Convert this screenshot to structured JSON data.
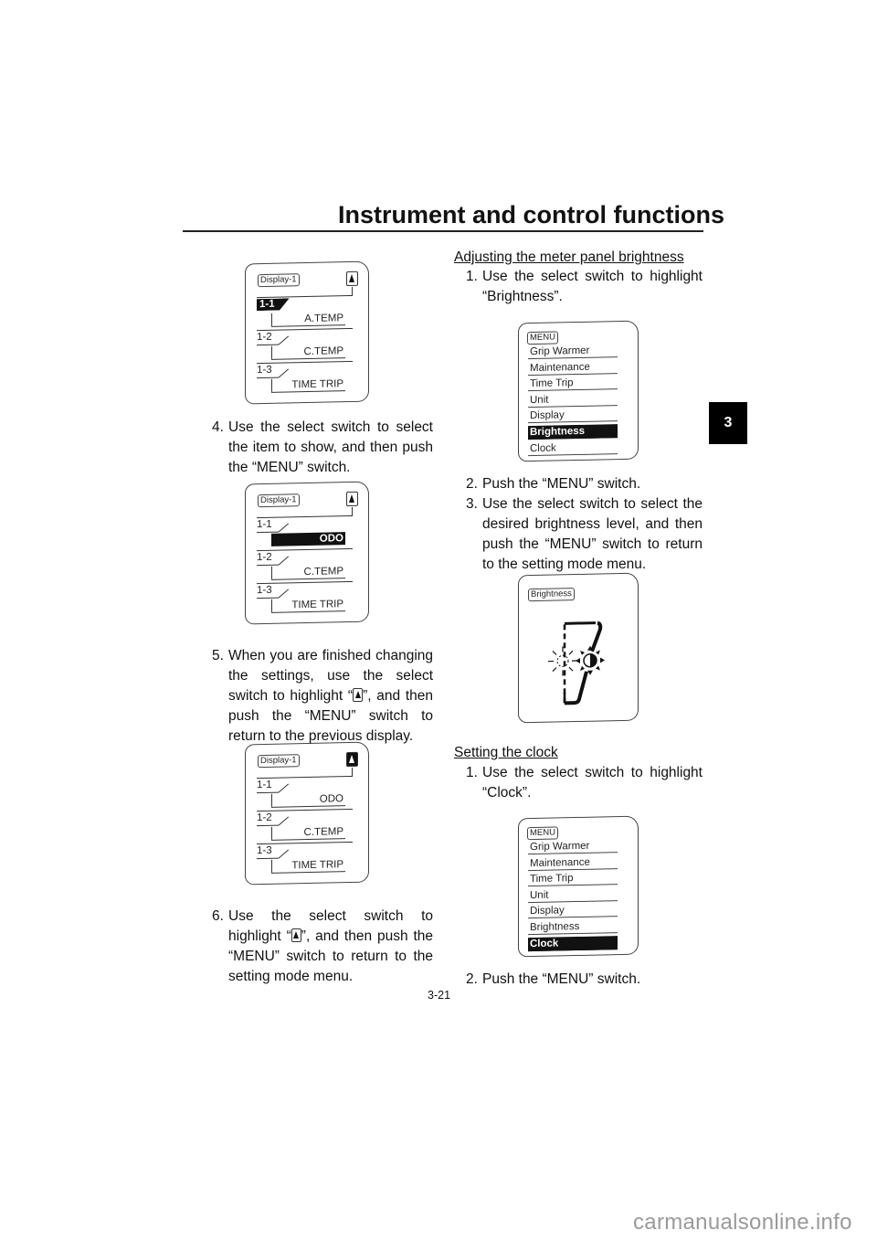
{
  "header": {
    "title": "Instrument and control functions"
  },
  "chapter_tab": "3",
  "left_column": {
    "figures": [
      {
        "label": "Display-1",
        "up_selected": false,
        "slots": [
          {
            "tag": "1-1",
            "tag_selected": true,
            "value": "A.TEMP",
            "value_selected": false
          },
          {
            "tag": "1-2",
            "tag_selected": false,
            "value": "C.TEMP",
            "value_selected": false
          },
          {
            "tag": "1-3",
            "tag_selected": false,
            "value": "TIME TRIP",
            "value_selected": false
          }
        ]
      },
      {
        "label": "Display-1",
        "up_selected": false,
        "slots": [
          {
            "tag": "1-1",
            "tag_selected": false,
            "value": "ODO",
            "value_selected": true
          },
          {
            "tag": "1-2",
            "tag_selected": false,
            "value": "C.TEMP",
            "value_selected": false
          },
          {
            "tag": "1-3",
            "tag_selected": false,
            "value": "TIME TRIP",
            "value_selected": false
          }
        ]
      },
      {
        "label": "Display-1",
        "up_selected": true,
        "slots": [
          {
            "tag": "1-1",
            "tag_selected": false,
            "value": "ODO",
            "value_selected": false
          },
          {
            "tag": "1-2",
            "tag_selected": false,
            "value": "C.TEMP",
            "value_selected": false
          },
          {
            "tag": "1-3",
            "tag_selected": false,
            "value": "TIME TRIP",
            "value_selected": false
          }
        ]
      }
    ],
    "steps": [
      {
        "num": "4.",
        "text": "Use the select switch to select the item to show, and then push the “MENU” switch."
      },
      {
        "num": "5.",
        "text_before": "When you are finished changing the settings, use the select switch to highlight “",
        "icon": "up-arrow-icon",
        "text_after": "”, and then push the “MENU” switch to return to the previous display."
      },
      {
        "num": "6.",
        "text_before": "Use the select switch to highlight “",
        "icon": "up-arrow-icon",
        "text_after": "”, and then push the “MENU” switch to return to the setting mode menu."
      }
    ]
  },
  "right_column": {
    "brightness_section": {
      "heading": "Adjusting the meter panel brightness",
      "steps": [
        {
          "num": "1.",
          "text": "Use the select switch to highlight “Brightness”."
        },
        {
          "num": "2.",
          "text": "Push the “MENU” switch."
        },
        {
          "num": "3.",
          "text": "Use the select switch to select the desired brightness level, and then push the “MENU” switch to return to the setting mode menu."
        }
      ],
      "menu_figure": {
        "label": "MENU",
        "items": [
          "Grip Warmer",
          "Maintenance",
          "Time Trip",
          "Unit",
          "Display",
          "Brightness",
          "Clock"
        ],
        "selected": "Brightness"
      },
      "brightness_figure": {
        "label": "Brightness",
        "icon": "brightness-adjust-icon"
      }
    },
    "clock_section": {
      "heading": "Setting the clock",
      "steps": [
        {
          "num": "1.",
          "text": "Use the select switch to highlight “Clock”."
        },
        {
          "num": "2.",
          "text": "Push the “MENU” switch."
        }
      ],
      "menu_figure": {
        "label": "MENU",
        "items": [
          "Grip Warmer",
          "Maintenance",
          "Time Trip",
          "Unit",
          "Display",
          "Brightness",
          "Clock"
        ],
        "selected": "Clock"
      }
    }
  },
  "footer": {
    "page_number": "3-21",
    "watermark": "carmanualsonline.info"
  }
}
